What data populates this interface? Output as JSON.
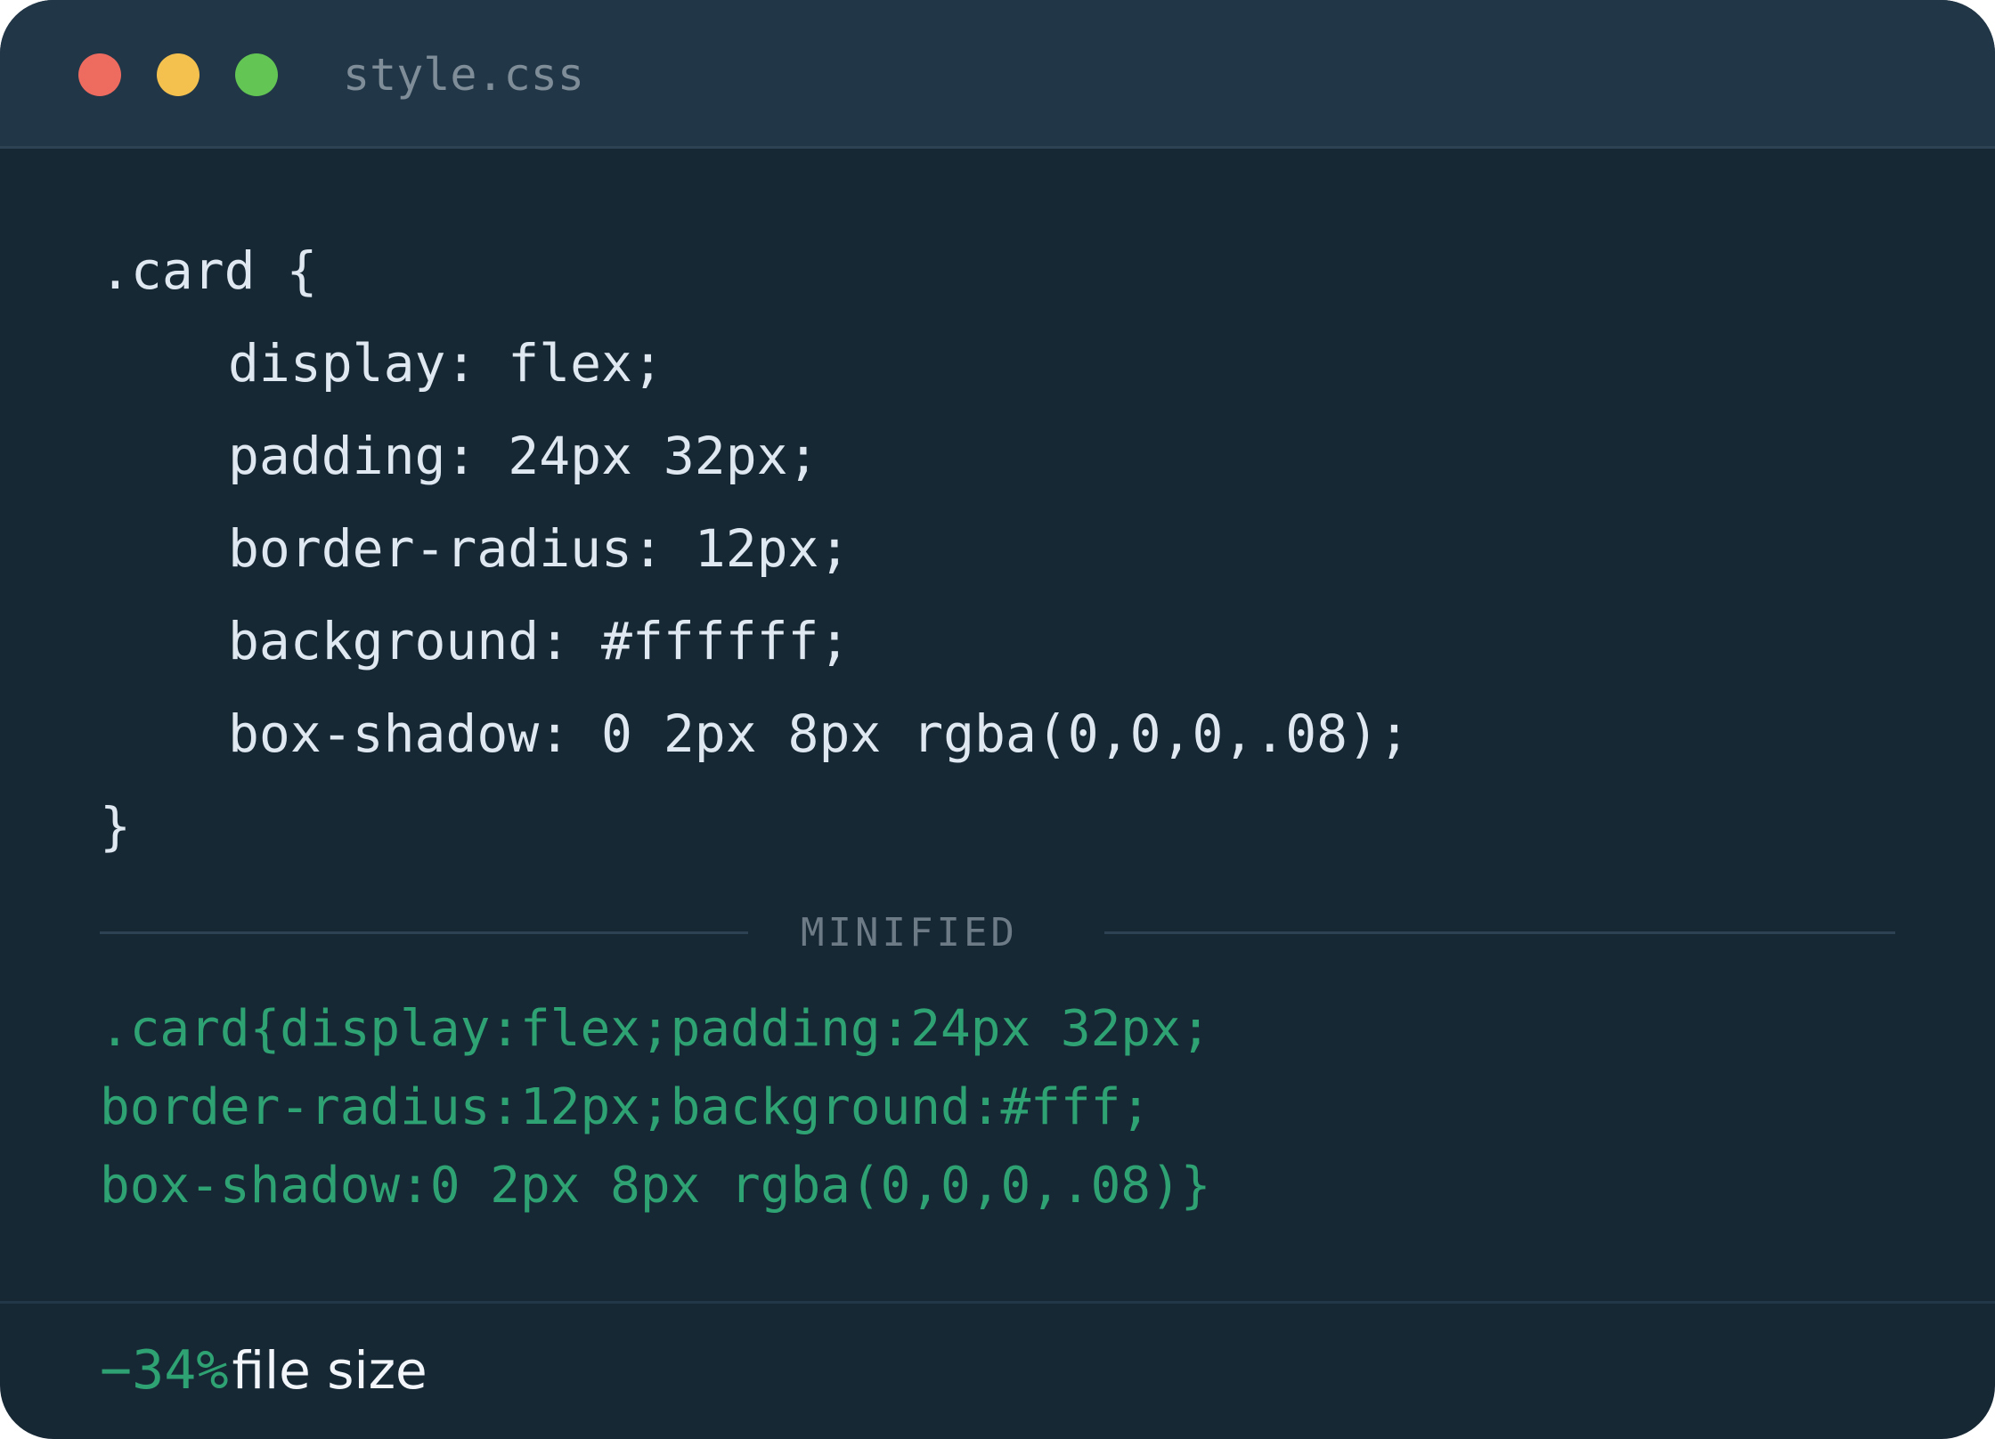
{
  "window": {
    "title": "style.css",
    "controls": [
      "close",
      "minimize",
      "maximize"
    ],
    "colors": {
      "background": "#172835",
      "titlebar": "#213647",
      "close": "#ee6b60",
      "minimize": "#f4c14f",
      "maximize": "#62c554",
      "accent": "#2fa273",
      "code_text": "#dfe8f0"
    }
  },
  "source_code": {
    "lines": [
      ".card {",
      "display: flex;",
      "padding: 24px 32px;",
      "border-radius: 12px;",
      "background: #ffffff;",
      "box-shadow: 0 2px 8px rgba(0,0,0,.08);",
      "}"
    ]
  },
  "divider": {
    "label": "MINIFIED"
  },
  "minified_code": {
    "lines": [
      ".card{display:flex;padding:24px 32px;",
      "border-radius:12px;background:#fff;",
      "box-shadow:0 2px 8px rgba(0,0,0,.08)}"
    ]
  },
  "footer": {
    "reduction": "−34%",
    "label": "file size"
  }
}
